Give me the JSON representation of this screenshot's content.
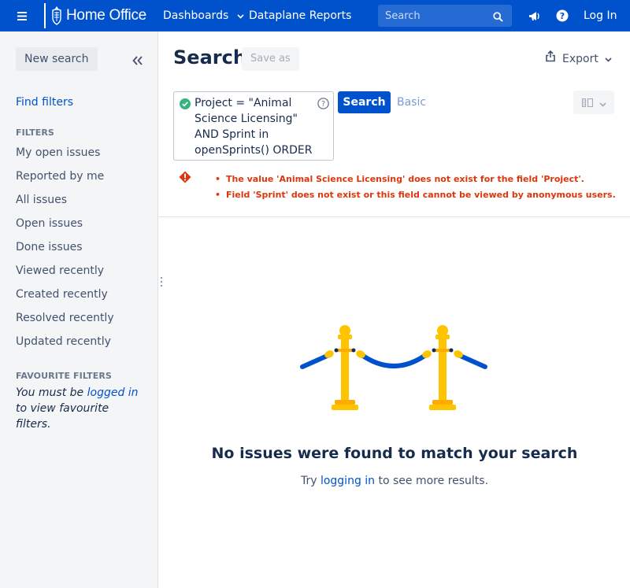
{
  "header": {
    "logo_text": "Home Office",
    "nav": {
      "dashboards": "Dashboards",
      "dataplane_reports": "Dataplane Reports"
    },
    "search_placeholder": "Search",
    "login": "Log In",
    "brand_color": "#0052cc"
  },
  "sidebar": {
    "new_search": "New search",
    "find_filters": "Find filters",
    "filters_heading": "FILTERS",
    "filters": [
      "My open issues",
      "Reported by me",
      "All issues",
      "Open issues",
      "Done issues",
      "Viewed recently",
      "Created recently",
      "Resolved recently",
      "Updated recently"
    ],
    "favourite_heading": "FAVOURITE FILTERS",
    "favourite_prefix": "You must be ",
    "favourite_link": "logged in",
    "favourite_suffix": " to view favourite filters."
  },
  "main": {
    "title": "Search",
    "save_as": "Save as",
    "export": "Export",
    "jql": "Project = \"Animal Science Licensing\" AND Sprint in openSprints() ORDER",
    "search_button": "Search",
    "basic_link": "Basic",
    "errors": [
      "The value 'Animal Science Licensing' does not exist for the field 'Project'.",
      "Field 'Sprint' does not exist or this field cannot be viewed by anonymous users."
    ],
    "empty_title": "No issues were found to match your search",
    "empty_prefix": "Try ",
    "empty_link": "logging in",
    "empty_suffix": " to see more results.",
    "error_color": "#de350b"
  }
}
